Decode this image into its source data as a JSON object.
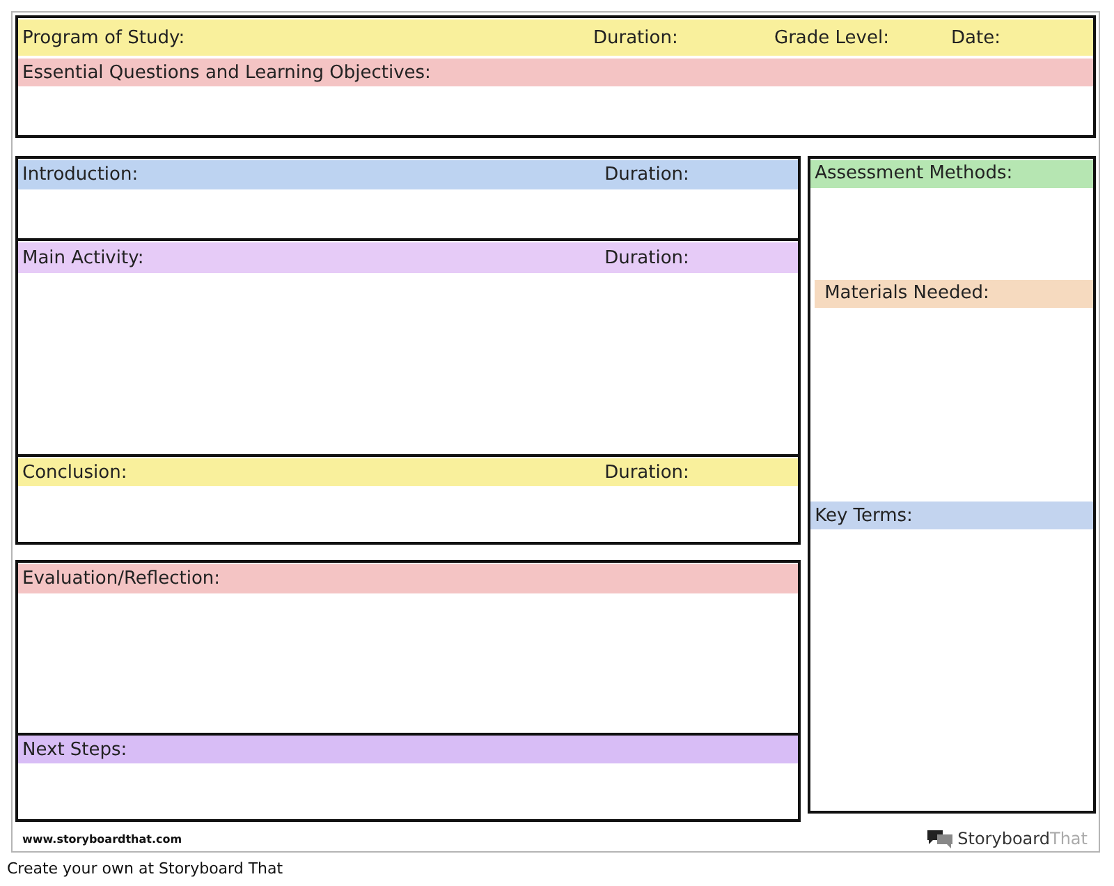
{
  "header": {
    "fields": [
      "Program of Study:",
      "Duration:",
      "Grade Level:",
      "Date:"
    ],
    "color": "#f9f09c"
  },
  "objectives": {
    "label": "Essential Questions and Learning Objectives:",
    "color": "#f4c4c4"
  },
  "lesson": [
    {
      "label": "Introduction:",
      "duration": "Duration:",
      "color": "#bdd3f1"
    },
    {
      "label": "Main Activity:",
      "duration": "Duration:",
      "color": "#e6cbf7"
    },
    {
      "label": "Conclusion:",
      "duration": "Duration:",
      "color": "#f9f09c"
    }
  ],
  "reflection": [
    {
      "label": "Evaluation/Reflection:",
      "color": "#f4c4c4"
    },
    {
      "label": "Next Steps:",
      "color": "#d8bdf6"
    }
  ],
  "side": [
    {
      "label": "Assessment Methods:",
      "color": "#b6e6b2"
    },
    {
      "label": "Materials Needed:",
      "color": "#f6dabf"
    },
    {
      "label": "Key Terms:",
      "color": "#c3d4ef"
    }
  ],
  "footer": {
    "url": "www.storyboardthat.com",
    "logo_main": "Storyboard",
    "logo_accent": "That"
  },
  "caption": "Create your own at Storyboard That"
}
